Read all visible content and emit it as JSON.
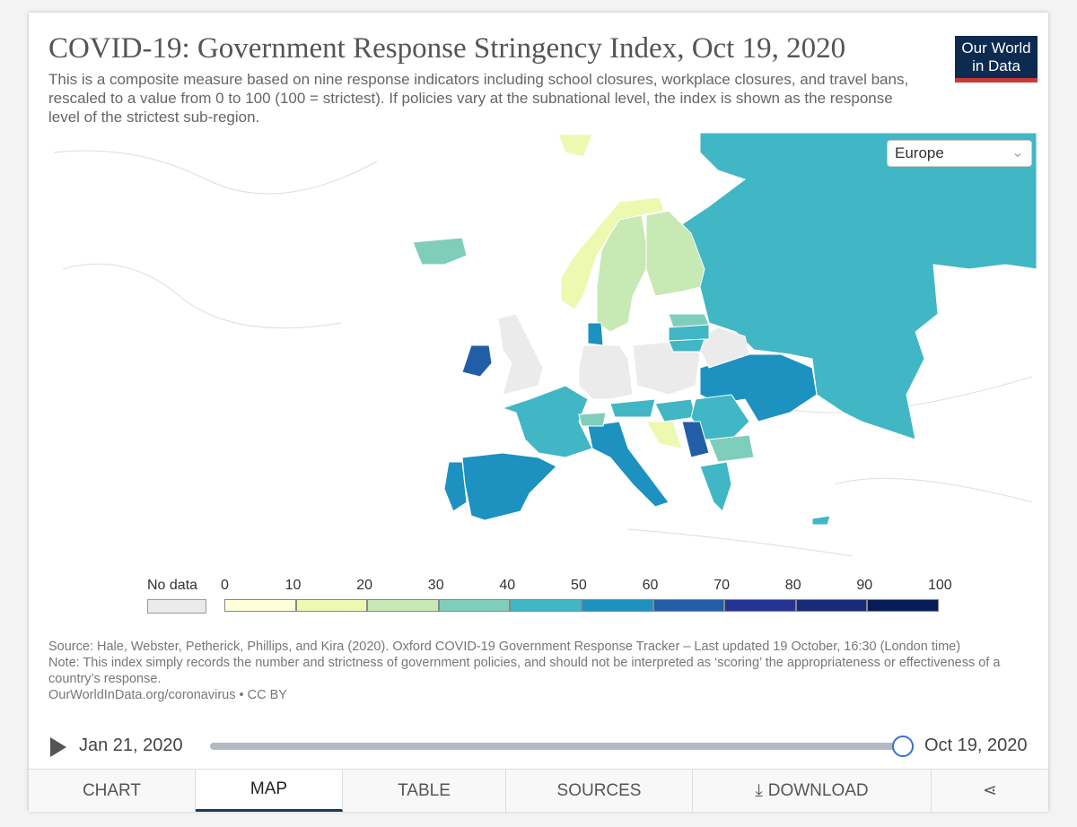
{
  "header": {
    "title": "COVID-19: Government Response Stringency Index, Oct 19, 2020",
    "subtitle": "This is a composite measure based on nine response indicators including school closures, workplace closures, and travel bans, rescaled to a value from 0 to 100 (100 = strictest). If policies vary at the subnational level, the index is shown as the response level of the strictest sub-region.",
    "logo": "Our World in Data"
  },
  "region_select": {
    "value": "Europe"
  },
  "legend": {
    "no_data_label": "No data",
    "no_data_color": "#ebebeb",
    "ticks": [
      "0",
      "10",
      "20",
      "30",
      "40",
      "50",
      "60",
      "70",
      "80",
      "90",
      "100"
    ],
    "colors": [
      "#ffffd9",
      "#edf8b1",
      "#c7e9b4",
      "#7fcdbb",
      "#41b6c4",
      "#1d91c0",
      "#225ea8",
      "#253494",
      "#1a2a7a",
      "#081d58"
    ]
  },
  "map_data": {
    "type": "choropleth",
    "region": "Europe",
    "date": "Oct 19, 2020",
    "values": {
      "Russia": 45,
      "Finland": 28,
      "Sweden": 25,
      "Norway": 15,
      "Svalbard": 15,
      "Iceland": 35,
      "Ireland": 65,
      "United Kingdom": null,
      "France": 45,
      "Spain": 55,
      "Portugal": 55,
      "Germany": null,
      "Poland": null,
      "Italy": 55,
      "Ukraine": 55,
      "Belarus": null,
      "Estonia": 30,
      "Latvia": 45,
      "Lithuania": 45,
      "Denmark": 55,
      "Austria": 45,
      "Switzerland": 35,
      "Hungary": 45,
      "Romania": 45,
      "Bulgaria": 35,
      "Serbia": 60,
      "Croatia": 15,
      "Greece": 45,
      "Cyprus": 45
    }
  },
  "footer": {
    "source": "Source: Hale, Webster, Petherick, Phillips, and Kira (2020). Oxford COVID-19 Government Response Tracker – Last updated 19 October, 16:30 (London time)",
    "note": "Note: This index simply records the number and strictness of government policies, and should not be interpreted as ‘scoring’ the appropriateness or effectiveness of a country’s response.",
    "url": "OurWorldInData.org/coronavirus • CC BY"
  },
  "timeline": {
    "start": "Jan 21, 2020",
    "end": "Oct 19, 2020",
    "position_fraction": 1.0
  },
  "tabs": [
    {
      "label": "CHART"
    },
    {
      "label": "MAP",
      "active": true
    },
    {
      "label": "TABLE"
    },
    {
      "label": "SOURCES"
    },
    {
      "label": "DOWNLOAD",
      "icon": "download-icon"
    },
    {
      "label": "",
      "icon": "share-icon"
    }
  ]
}
